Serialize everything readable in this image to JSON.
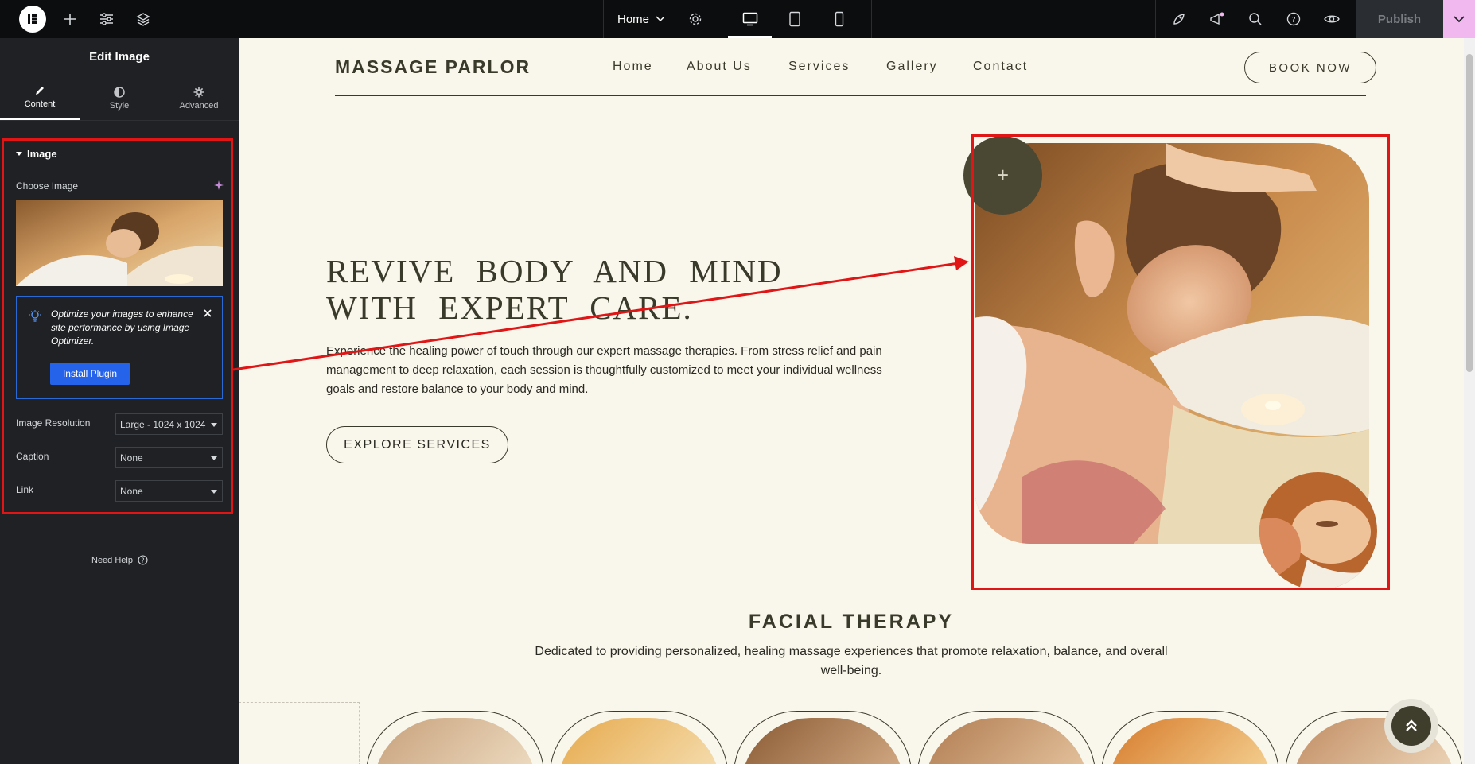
{
  "topbar": {
    "page_name": "Home",
    "publish_label": "Publish"
  },
  "panel": {
    "title": "Edit Image",
    "tabs": [
      {
        "label": "Content"
      },
      {
        "label": "Style"
      },
      {
        "label": "Advanced"
      }
    ],
    "section_title": "Image",
    "choose_image_label": "Choose Image",
    "notice_text": "Optimize your images to enhance site performance by using Image Optimizer.",
    "install_label": "Install Plugin",
    "resolution_label": "Image Resolution",
    "resolution_value": "Large - 1024 x 1024",
    "caption_label": "Caption",
    "caption_value": "None",
    "link_label": "Link",
    "link_value": "None",
    "help_label": "Need Help"
  },
  "site": {
    "brand": "MASSAGE PARLOR",
    "nav": [
      "Home",
      "About Us",
      "Services",
      "Gallery",
      "Contact"
    ],
    "book_label": "BOOK NOW",
    "hero_title": "REVIVE BODY AND MIND WITH EXPERT CARE.",
    "hero_desc": "Experience the healing power of touch through our expert massage therapies. From stress relief and pain management to deep relaxation, each session is thoughtfully customized to meet your individual wellness goals and restore balance to your body and mind.",
    "explore_label": "EXPLORE SERVICES",
    "section_title": "FACIAL THERAPY",
    "section_desc": "Dedicated to providing personalized, healing massage experiences that promote relaxation, balance, and overall well-being."
  },
  "colors": {
    "accent_red": "#e01515",
    "brand_dark": "#3a3a2a",
    "editor_blue": "#2563eb",
    "publish_pink": "#f0b8ef"
  }
}
